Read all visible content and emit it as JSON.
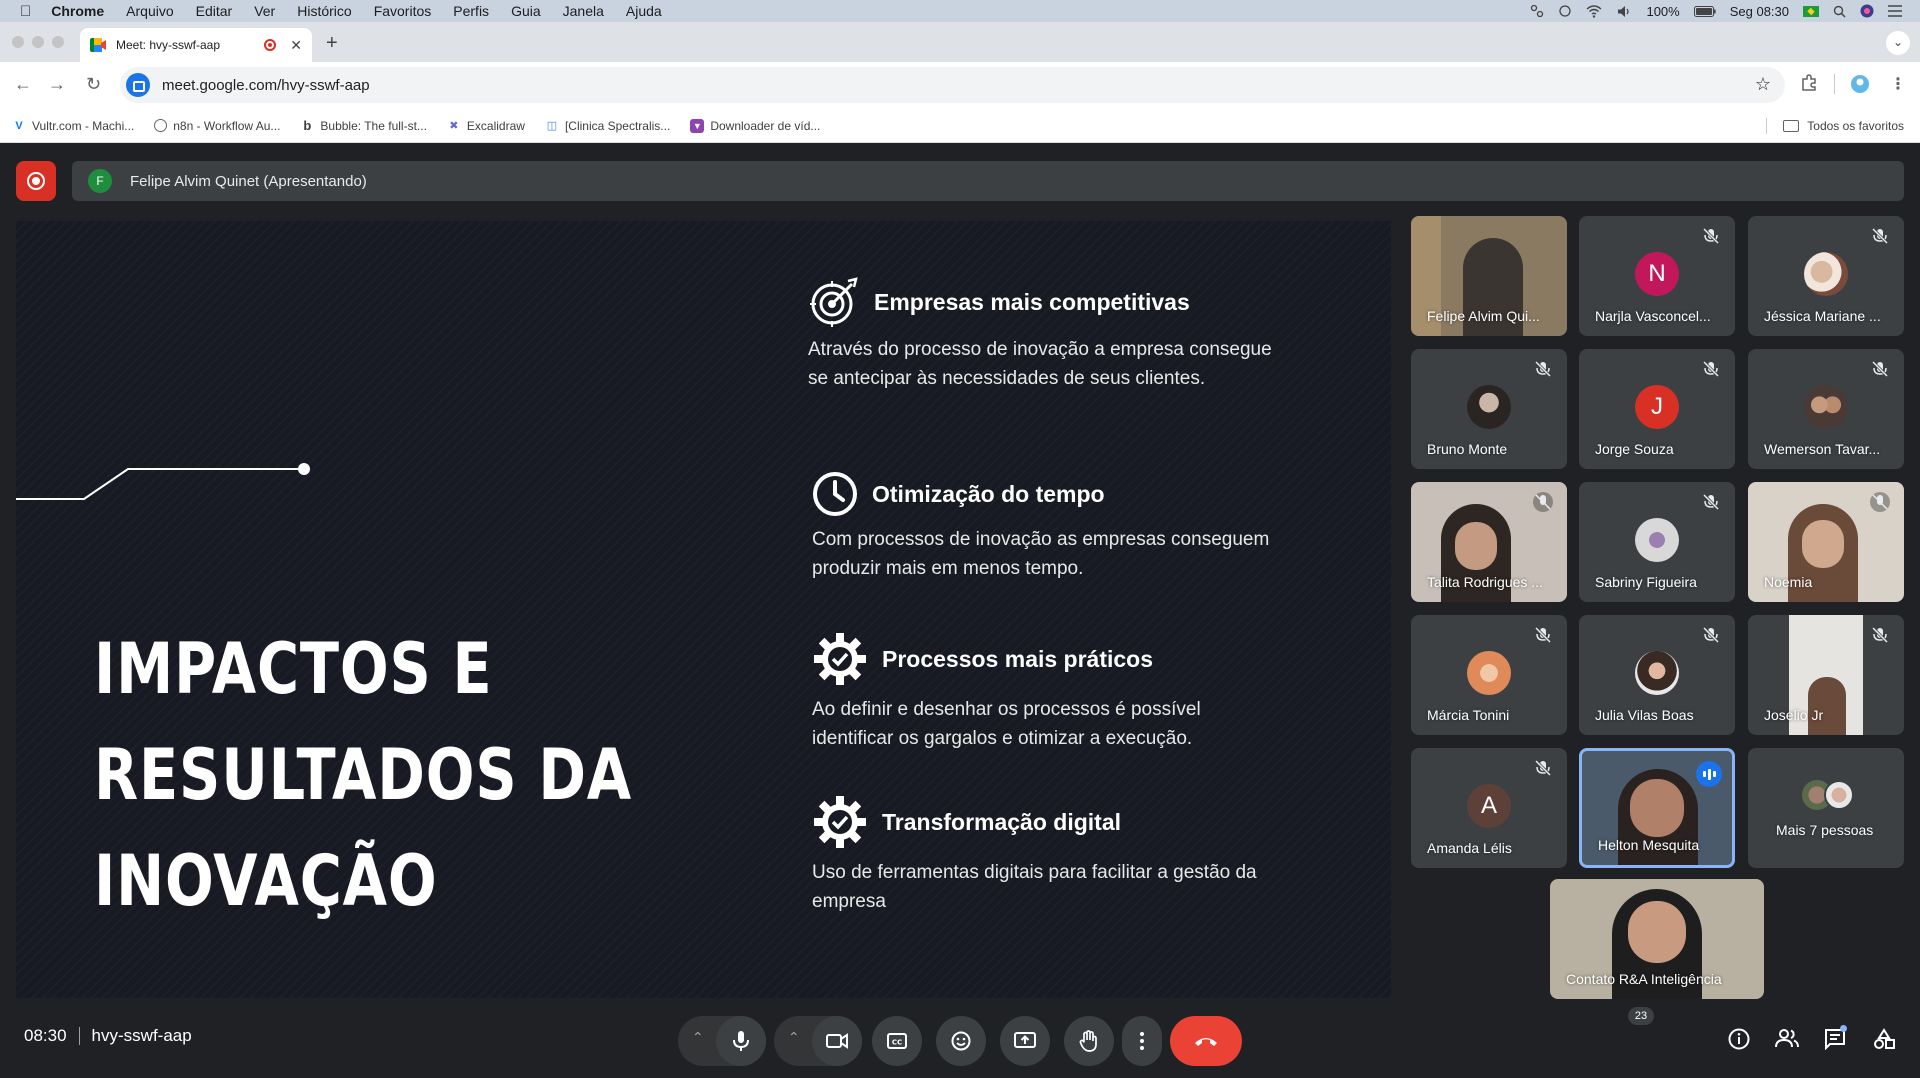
{
  "menubar": {
    "app": "Chrome",
    "items": [
      "Arquivo",
      "Editar",
      "Ver",
      "Histórico",
      "Favoritos",
      "Perfis",
      "Guia",
      "Janela",
      "Ajuda"
    ],
    "battery": "100%",
    "datetime": "Seg 08:30"
  },
  "tab": {
    "title": "Meet: hvy-sswf-aap"
  },
  "address": {
    "url": "meet.google.com/hvy-sswf-aap"
  },
  "bookmarks": {
    "items": [
      {
        "label": "Vultr.com - Machi...",
        "icon": "vultr-icon",
        "color": "#007bfc"
      },
      {
        "label": "n8n - Workflow Au...",
        "icon": "globe-icon",
        "color": "#5f6368"
      },
      {
        "label": "Bubble: The full-st...",
        "icon": "bubble-icon",
        "color": "#202124"
      },
      {
        "label": "Excalidraw",
        "icon": "excalidraw-icon",
        "color": "#6965db"
      },
      {
        "label": "[Clinica Spectralis...",
        "icon": "clinic-icon",
        "color": "#4285f4"
      },
      {
        "label": "Downloader de víd...",
        "icon": "downloader-icon",
        "color": "#8e44ad"
      }
    ],
    "all_label": "Todos os favoritos"
  },
  "meet": {
    "presenter": {
      "initial": "F",
      "label": "Felipe Alvim Quinet (Apresentando)"
    },
    "slide": {
      "title_lines": [
        "IMPACTOS E",
        "RESULTADOS DA",
        "INOVAÇÃO"
      ],
      "items": [
        {
          "icon": "target-icon",
          "title": "Empresas mais competitivas",
          "desc_lines": [
            "Através do processo de inovação a empresa consegue",
            "se antecipar às necessidades de seus clientes."
          ]
        },
        {
          "icon": "clock-icon",
          "title": "Otimização do tempo",
          "desc_lines": [
            "Com processos de inovação as empresas conseguem",
            "produzir mais em menos tempo."
          ]
        },
        {
          "icon": "gear-check-icon",
          "title": "Processos mais práticos",
          "desc_lines": [
            "Ao definir e desenhar os processos é possível",
            "identificar os gargalos e otimizar a execução."
          ]
        },
        {
          "icon": "gear-check-icon",
          "title": "Transformação digital",
          "desc_lines": [
            "Uso de ferramentas digitais para facilitar a gestão da",
            "empresa"
          ]
        }
      ]
    },
    "participants": [
      {
        "name": "Felipe Alvim Qui...",
        "kind": "video",
        "muted": false
      },
      {
        "name": "Narjla Vasconcel...",
        "kind": "letter",
        "letter": "N",
        "color": "#c2185b",
        "muted": true
      },
      {
        "name": "Jéssica Mariane ...",
        "kind": "photo",
        "muted": true
      },
      {
        "name": "Bruno Monte",
        "kind": "photo",
        "muted": true
      },
      {
        "name": "Jorge Souza",
        "kind": "letter",
        "letter": "J",
        "color": "#d93025",
        "muted": true
      },
      {
        "name": "Wemerson Tavar...",
        "kind": "photo",
        "muted": true
      },
      {
        "name": "Talita Rodrigues ...",
        "kind": "video",
        "muted": true
      },
      {
        "name": "Sabriny Figueira",
        "kind": "photo",
        "muted": true
      },
      {
        "name": "Noemia",
        "kind": "video",
        "muted": true
      },
      {
        "name": "Márcia Tonini",
        "kind": "photo",
        "muted": true
      },
      {
        "name": "Julia Vilas Boas",
        "kind": "photo",
        "muted": true
      },
      {
        "name": "Joselio Jr",
        "kind": "video",
        "muted": true
      },
      {
        "name": "Amanda Lélis",
        "kind": "letter",
        "letter": "A",
        "color": "#5d4037",
        "muted": true
      },
      {
        "name": "Helton Mesquita",
        "kind": "video",
        "muted": false,
        "speaking": true
      },
      {
        "name": "Mais 7 pessoas",
        "kind": "more"
      },
      {
        "name": "Contato R&A Inteligência",
        "kind": "video",
        "muted": false
      }
    ],
    "bottom": {
      "time": "08:30",
      "code": "hvy-sswf-aap",
      "people_count": "23"
    }
  },
  "colors": {
    "end_call": "#ea4335",
    "rec": "#d93025",
    "accent": "#8ab4f8"
  }
}
